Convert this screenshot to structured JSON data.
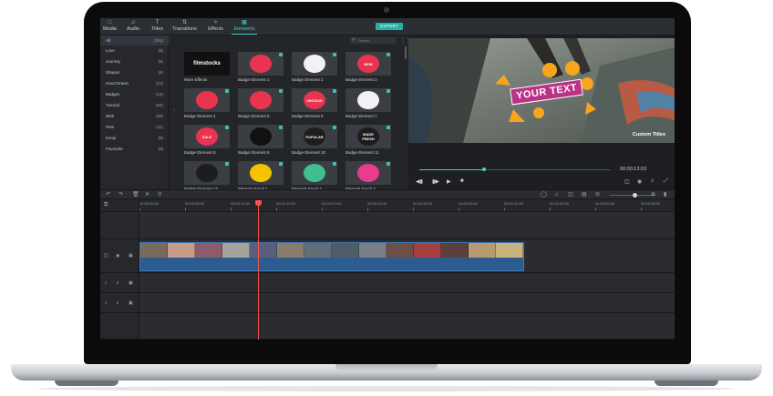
{
  "tabs": [
    {
      "label": "Media",
      "icon": "folder-icon"
    },
    {
      "label": "Audio",
      "icon": "music-note-icon"
    },
    {
      "label": "Titles",
      "icon": "text-icon"
    },
    {
      "label": "Transitions",
      "icon": "transition-icon"
    },
    {
      "label": "Effects",
      "icon": "effects-icon"
    },
    {
      "label": "Elements",
      "icon": "elements-icon",
      "active": true
    }
  ],
  "export_label": "EXPORT",
  "categories": [
    {
      "name": "All",
      "count": "(191)",
      "active": true
    },
    {
      "name": "Love",
      "count": "(8)"
    },
    {
      "name": "Journey",
      "count": "(6)"
    },
    {
      "name": "Shapes",
      "count": "(6)"
    },
    {
      "name": "Hand Drawn",
      "count": "(21)"
    },
    {
      "name": "Badges",
      "count": "(12)"
    },
    {
      "name": "Tutorial",
      "count": "(64)"
    },
    {
      "name": "Web",
      "count": "(56)"
    },
    {
      "name": "Pets",
      "count": "(11)"
    },
    {
      "name": "Emoji",
      "count": "(9)"
    },
    {
      "name": "Favourite",
      "count": "(0)"
    }
  ],
  "search": {
    "placeholder": "Search"
  },
  "elements": [
    {
      "label": "More Effects",
      "thumb_text": "filmstocks",
      "bg": "#111111",
      "fg": "#ffffff"
    },
    {
      "label": "Badge Element 1",
      "thumb_text": "",
      "bg": "#3a3d42",
      "fg": "#e8344f"
    },
    {
      "label": "Badge Element 2",
      "thumb_text": "",
      "bg": "#3a3d42",
      "fg": "#f2f2f2"
    },
    {
      "label": "Badge Element 3",
      "thumb_text": "NEW",
      "bg": "#3a3d42",
      "fg": "#e8344f"
    },
    {
      "label": "Badge Element 4",
      "thumb_text": "",
      "bg": "#3a3d42",
      "fg": "#e8344f"
    },
    {
      "label": "Badge Element 5",
      "thumb_text": "",
      "bg": "#3a3d42",
      "fg": "#e8344f"
    },
    {
      "label": "Badge Element 6",
      "thumb_text": "VINTAGE",
      "bg": "#3a3d42",
      "fg": "#e8344f"
    },
    {
      "label": "Badge Element 7",
      "thumb_text": "",
      "bg": "#3a3d42",
      "fg": "#f2f2f2"
    },
    {
      "label": "Badge Element 8",
      "thumb_text": "SALE",
      "bg": "#3a3d42",
      "fg": "#e8344f"
    },
    {
      "label": "Badge Element 9",
      "thumb_text": "",
      "bg": "#3a3d42",
      "fg": "#111111"
    },
    {
      "label": "Badge Element 10",
      "thumb_text": "POPULAR",
      "bg": "#3a3d42",
      "fg": "#1d1d1d"
    },
    {
      "label": "Badge Element 11",
      "thumb_text": "MADE FRESH",
      "bg": "#3a3d42",
      "fg": "#1d1d1d"
    },
    {
      "label": "Badge Element 12",
      "thumb_text": "",
      "bg": "#3a3d42",
      "fg": "#1d1d1d"
    },
    {
      "label": "Element Emoji 1",
      "thumb_text": "",
      "bg": "#3a3d42",
      "fg": "#f5c400"
    },
    {
      "label": "Element Emoji 2",
      "thumb_text": "",
      "bg": "#3a3d42",
      "fg": "#3fbf8f"
    },
    {
      "label": "Element Emoji 3",
      "thumb_text": "",
      "bg": "#3a3d42",
      "fg": "#e93c8c"
    }
  ],
  "preview": {
    "title_text": "YOUR TEXT",
    "caption": "Custom Titles",
    "timecode": "00:00:13:03",
    "progress": 0.34
  },
  "ruler": [
    "00:00:00:00",
    "00:00:05:00",
    "00:00:10:00",
    "00:00:15:00",
    "00:00:20:00",
    "00:00:25:00",
    "00:00:30:00",
    "00:00:35:00",
    "00:00:40:00",
    "00:00:45:00",
    "00:00:50:00",
    "00:00:55:00"
  ],
  "clip_colors": [
    "#7a6a5e",
    "#c79b86",
    "#8d5b6a",
    "#a5a39a",
    "#5b5f7a",
    "#8a7c6d",
    "#5f6e77",
    "#4f5e66",
    "#7a7f85",
    "#6e4f48",
    "#a64040",
    "#5a3f3b",
    "#b89a70",
    "#c9b37d"
  ],
  "colors": {
    "accent": "#41d1c6",
    "playhead": "#ff4f4f",
    "clip": "#2c5b8f"
  }
}
